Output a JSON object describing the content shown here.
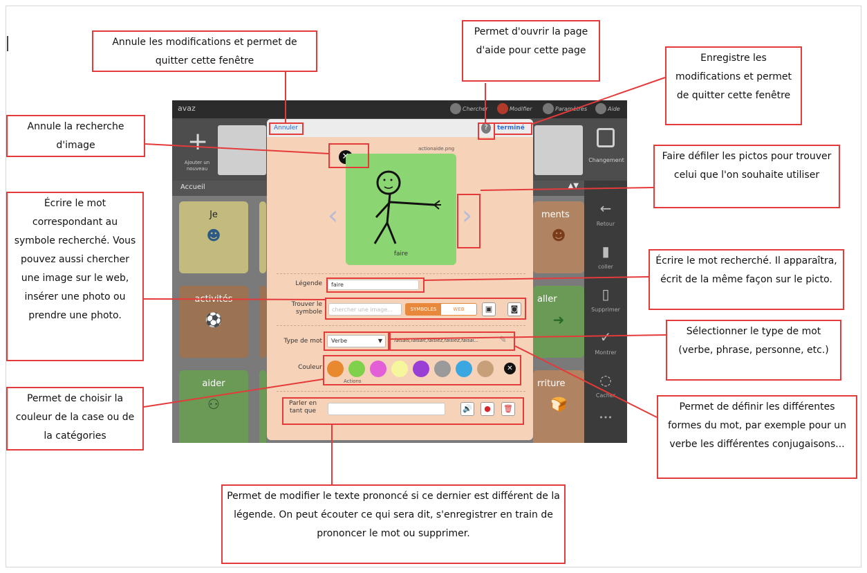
{
  "app": {
    "title": "avaz",
    "topbar_items": [
      "Chercher",
      "Modifier",
      "Paramètres",
      "Aide"
    ],
    "add_label": "Ajouter un nouveau",
    "change_label": "Changement",
    "breadcrumb": "Accueil",
    "page_arrows": "▲▼",
    "tiles": [
      {
        "label": "Je",
        "icon": "person-icon"
      },
      {
        "label": "activités",
        "icon": "activities-icon"
      },
      {
        "label": "aider",
        "icon": "help-people-icon"
      },
      {
        "label": "ments",
        "icon": "clothes-icon"
      },
      {
        "label": "aller",
        "icon": "arrow-icon"
      },
      {
        "label": "rriture",
        "icon": "food-icon"
      }
    ],
    "sidebar": {
      "retour": "Retour",
      "coller": "coller",
      "supprimer": "Supprimer",
      "montrer": "Montrer",
      "cacher": "Cacher",
      "more": "•••"
    }
  },
  "modal": {
    "cancel": "Annuler",
    "help": "?",
    "done": "terminé",
    "filename": "actionaide.png",
    "picto_label": "faire",
    "legend_label": "Légende",
    "legend_value": "faire",
    "find_label": "Trouver le symbole",
    "search_placeholder": "chercher une image...",
    "seg_symbols": "SYMBOLES",
    "seg_web": "WEB",
    "word_type_label": "Type de mot",
    "word_type_value": "Verbe",
    "word_forms": "faisais,faisait,faisiez,faisiez,faisai...",
    "color_label": "Couleur",
    "color_caption": "Actions",
    "speak_label": "Parler en tant que",
    "colors": [
      "#e8882f",
      "#7fd14b",
      "#e35fd8",
      "#f6f69c",
      "#9a3fd6",
      "#9a9a9a",
      "#3aa7e0",
      "#c7a07a"
    ]
  },
  "annotations": {
    "cancel_note": "Annule les modifications et permet de quitter cette fenêtre",
    "help_note": "Permet d'ouvrir la page d'aide pour cette page",
    "save_note": "Enregistre les modifications et permet de quitter cette fenêtre",
    "cancel_search_note": "Annule la recherche d'image",
    "scroll_note": "Faire défiler les pictos pour trouver celui que l'on souhaite utiliser",
    "write_word_note": "Écrire le mot correspondant au symbole recherché. Vous pouvez aussi chercher une image sur le web, insérer une photo ou prendre une photo.",
    "legend_note": "Écrire le mot recherché. Il apparaîtra, écrit de la même façon sur le picto.",
    "word_type_note": "Sélectionner le type de mot (verbe, phrase, personne, etc.)",
    "color_note": "Permet de choisir la couleur de la case ou de la catégories",
    "forms_note": "Permet de définir les différentes formes du mot, par exemple pour un verbe les différentes conjugaisons...",
    "speak_note": "Permet de modifier le texte prononcé si ce dernier est différent de la légende. On peut écouter ce qui sera dit, s'enregistrer en train de prononcer le mot ou supprimer."
  }
}
